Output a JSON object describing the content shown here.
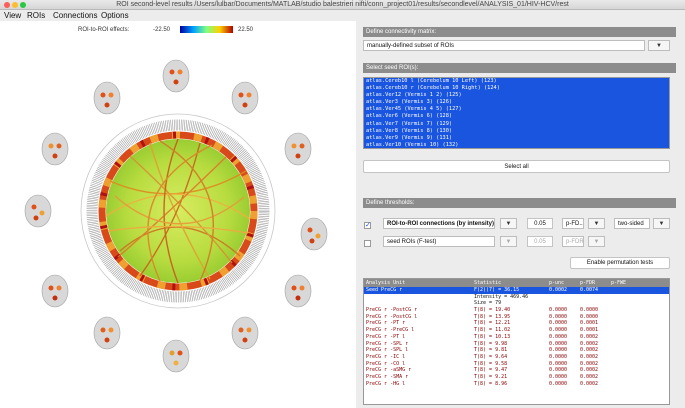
{
  "window": {
    "title": "ROI second-level results /Users/lulbar/Documents/MATLAB/studio balestrieri nifti/conn_project01/results/secondlevel/ANALYSIS_01/HIV-HCV/rest"
  },
  "menu": [
    "View",
    "ROIs",
    "Connections",
    "Options"
  ],
  "colorbar": {
    "label": "ROI-to-ROI effects:",
    "min": "-22.50",
    "max": "22.50"
  },
  "connectivity": {
    "header": "Define connectivity matrix:",
    "value": "manually-defined subset of ROIs"
  },
  "seeds": {
    "header": "Select seed ROI(s):",
    "items": [
      "atlas.Cereb10 l (Cerebelum 10 Left) (123)",
      "atlas.Cereb10 r (Cerebelum 10 Right) (124)",
      "atlas.Ver12 (Vermis 1 2) (125)",
      "atlas.Ver3 (Vermis 3) (126)",
      "atlas.Ver45 (Vermis 4 5) (127)",
      "atlas.Ver6 (Vermis 6) (128)",
      "atlas.Ver7 (Vermis 7) (129)",
      "atlas.Ver8 (Vermis 8) (130)",
      "atlas.Ver9 (Vermis 9) (131)",
      "atlas.Ver10 (Vermis 10) (132)"
    ],
    "select_all": "Select all"
  },
  "thresholds": {
    "header": "Define thresholds:",
    "row1": {
      "checked": "✓",
      "measure": "ROI-to-ROI connections (by intensity)",
      "value": "0.05",
      "correction": "p-FD...",
      "sided": "two-sided"
    },
    "row2": {
      "measure": "seed ROIs (F-test)",
      "value": "0.05",
      "correction": "p-FDR"
    },
    "permutation": "Enable permutation tests"
  },
  "results": {
    "columns": [
      "Analysis Unit",
      "Statistic",
      "p-unc",
      "p-FDR",
      "p-FWE"
    ],
    "rows": [
      {
        "unit": "Seed  PreCG r",
        "stat": "F(2)(7) = 36.15",
        "punc": "0.0002",
        "pfdr": "0.0074",
        "type": "sel"
      },
      {
        "unit": "",
        "stat": "Intensity = 469.46",
        "punc": "",
        "pfdr": "",
        "type": "info"
      },
      {
        "unit": "",
        "stat": "Size = 79",
        "punc": "",
        "pfdr": "",
        "type": "info"
      },
      {
        "unit": "  PreCG r -PostCG r",
        "stat": "T(8) = 19.40",
        "punc": "0.0000",
        "pfdr": "0.0000",
        "type": "conn"
      },
      {
        "unit": "  PreCG r -PostCG l",
        "stat": "T(8) = 13.95",
        "punc": "0.0000",
        "pfdr": "0.0000",
        "type": "conn"
      },
      {
        "unit": "  PreCG r -PT r",
        "stat": "T(8) = 12.21",
        "punc": "0.0000",
        "pfdr": "0.0001",
        "type": "conn"
      },
      {
        "unit": "  PreCG r -PreCG l",
        "stat": "T(8) = 11.02",
        "punc": "0.0000",
        "pfdr": "0.0001",
        "type": "conn"
      },
      {
        "unit": "  PreCG r -PT l",
        "stat": "T(8) = 10.13",
        "punc": "0.0000",
        "pfdr": "0.0002",
        "type": "conn"
      },
      {
        "unit": "  PreCG r -SPL r",
        "stat": "T(8) = 9.98",
        "punc": "0.0000",
        "pfdr": "0.0002",
        "type": "conn"
      },
      {
        "unit": "  PreCG r -SPL l",
        "stat": "T(8) = 9.81",
        "punc": "0.0000",
        "pfdr": "0.0002",
        "type": "conn"
      },
      {
        "unit": "  PreCG r -IC l",
        "stat": "T(8) = 9.64",
        "punc": "0.0000",
        "pfdr": "0.0002",
        "type": "conn"
      },
      {
        "unit": "  PreCG r -CO l",
        "stat": "T(8) = 9.58",
        "punc": "0.0000",
        "pfdr": "0.0002",
        "type": "conn"
      },
      {
        "unit": "  PreCG r -aSMG r",
        "stat": "T(8) = 9.47",
        "punc": "0.0000",
        "pfdr": "0.0002",
        "type": "conn"
      },
      {
        "unit": "  PreCG r -SMA r",
        "stat": "T(8) = 9.21",
        "punc": "0.0000",
        "pfdr": "0.0002",
        "type": "conn"
      },
      {
        "unit": "  PreCG r -HG l",
        "stat": "T(8) = 8.96",
        "punc": "0.0000",
        "pfdr": "0.0002",
        "type": "conn"
      }
    ]
  },
  "colors": {
    "selection": "#1a55e0",
    "result_text": "#8b0000",
    "section_header": "#8c8c8c"
  },
  "icons": {
    "close": "close-traffic-light",
    "minimize": "minimize-traffic-light",
    "zoom": "zoom-traffic-light",
    "dropdown": "chevron-down-icon"
  }
}
